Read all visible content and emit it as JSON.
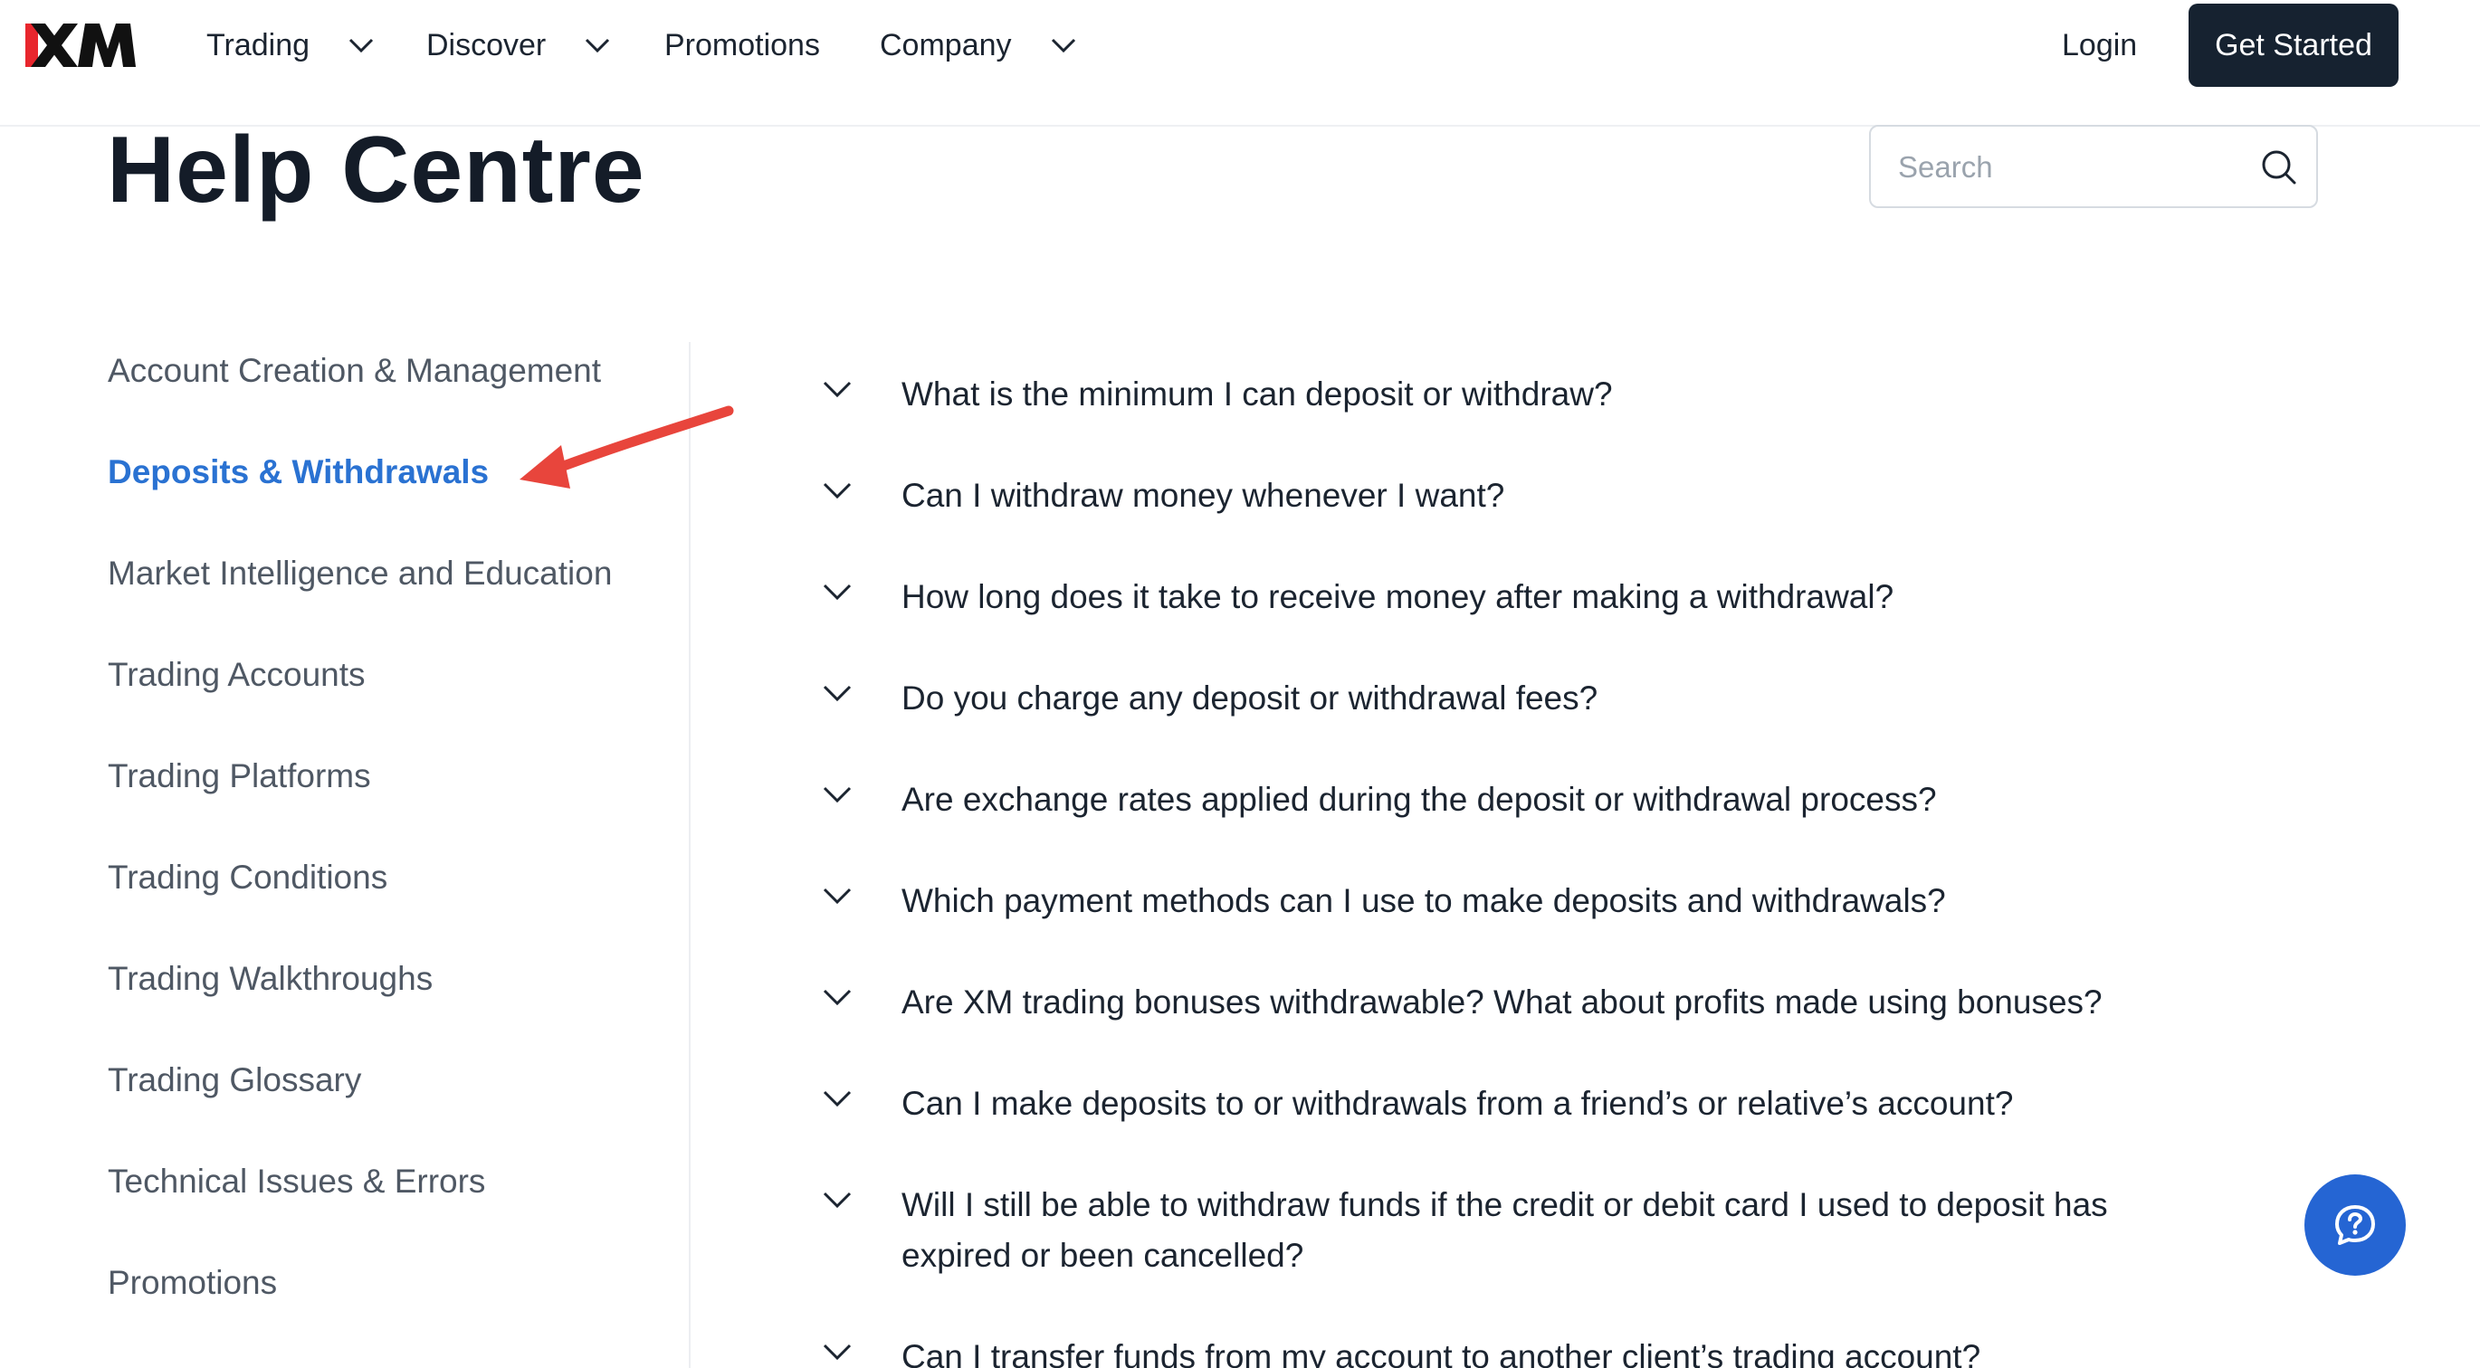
{
  "header": {
    "brand": "XM",
    "nav": [
      {
        "label": "Trading",
        "has_dropdown": true
      },
      {
        "label": "Discover",
        "has_dropdown": true
      },
      {
        "label": "Promotions",
        "has_dropdown": false
      },
      {
        "label": "Company",
        "has_dropdown": true
      }
    ],
    "login_label": "Login",
    "get_started_label": "Get Started"
  },
  "page": {
    "title": "Help Centre",
    "search": {
      "placeholder": "Search",
      "value": ""
    }
  },
  "sidebar": {
    "items": [
      {
        "label": "Account Creation & Management",
        "active": false
      },
      {
        "label": "Deposits & Withdrawals",
        "active": true
      },
      {
        "label": "Market Intelligence and Education",
        "active": false
      },
      {
        "label": "Trading Accounts",
        "active": false
      },
      {
        "label": "Trading Platforms",
        "active": false
      },
      {
        "label": "Trading Conditions",
        "active": false
      },
      {
        "label": "Trading Walkthroughs",
        "active": false
      },
      {
        "label": "Trading Glossary",
        "active": false
      },
      {
        "label": "Technical Issues & Errors",
        "active": false
      },
      {
        "label": "Promotions",
        "active": false
      }
    ]
  },
  "faq": {
    "questions": [
      "What is the minimum I can deposit or withdraw?",
      "Can I withdraw money whenever I want?",
      "How long does it take to receive money after making a withdrawal?",
      "Do you charge any deposit or withdrawal fees?",
      "Are exchange rates applied during the deposit or withdrawal process?",
      "Which payment methods can I use to make deposits and withdrawals?",
      "Are XM trading bonuses withdrawable? What about profits made using bonuses?",
      "Can I make deposits to or withdrawals from a friend’s or relative’s account?",
      "Will I still be able to withdraw funds if the credit or debit card I used to deposit has expired or been cancelled?",
      "Can I transfer funds from my account to another client’s trading account?"
    ]
  },
  "colors": {
    "accent": "#2a72d2",
    "button_dark": "#162230",
    "chat_button": "#2565d3",
    "annotation_arrow": "#e8453c"
  },
  "icons": {
    "chevron": "chevron-down-icon",
    "search": "search-icon",
    "chat": "chat-help-icon",
    "annotation": "red-arrow-annotation"
  }
}
